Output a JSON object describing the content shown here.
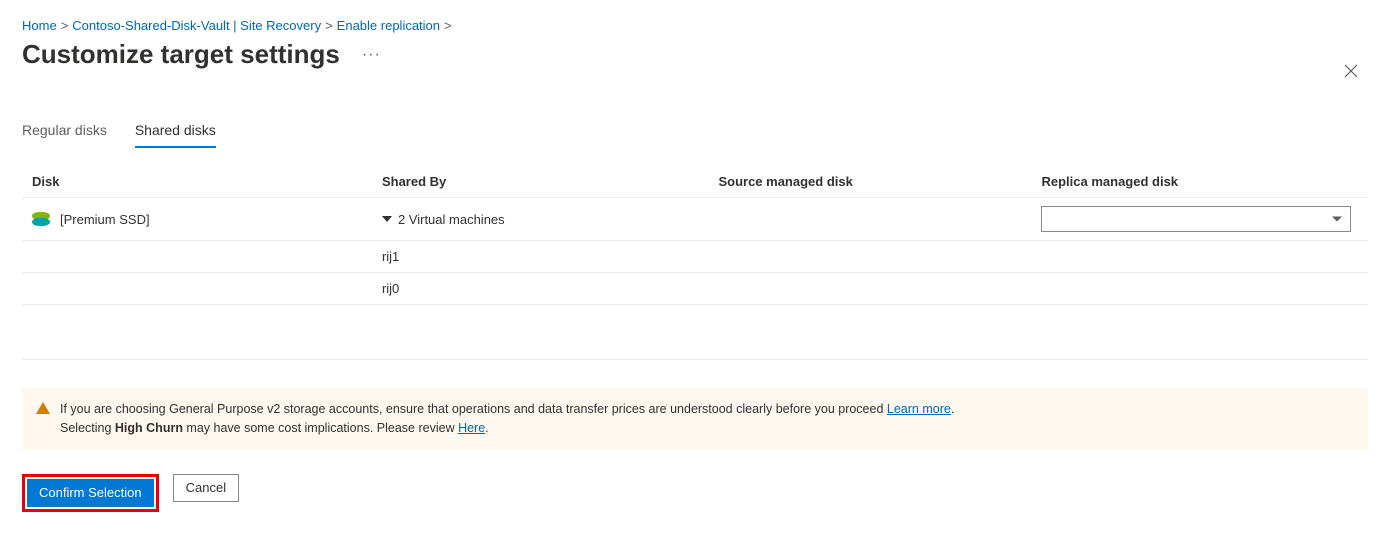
{
  "breadcrumb": {
    "items": [
      "Home",
      "Contoso-Shared-Disk-Vault | Site Recovery",
      "Enable replication"
    ],
    "sep": ">"
  },
  "header": {
    "title": "Customize target settings",
    "more": "···"
  },
  "tabs": {
    "items": [
      {
        "label": "Regular disks",
        "active": false
      },
      {
        "label": "Shared disks",
        "active": true
      }
    ]
  },
  "table": {
    "columns": {
      "disk": "Disk",
      "shared_by": "Shared By",
      "source": "Source managed disk",
      "replica": "Replica managed disk"
    },
    "rows": [
      {
        "disk_label": "[Premium SSD]",
        "shared_by": "2 Virtual machines",
        "source": "",
        "replica": ""
      }
    ],
    "subrows": [
      "rij1",
      "rij0"
    ]
  },
  "info": {
    "text1": "If you are choosing General Purpose v2 storage accounts, ensure that operations and data transfer prices are understood clearly before you proceed ",
    "learn_more": "Learn more",
    "period": ".",
    "text2a": "Selecting ",
    "bold": "High Churn",
    "text2b": " may have some cost implications. Please review ",
    "here": "Here",
    "period2": "."
  },
  "buttons": {
    "confirm": "Confirm Selection",
    "cancel": "Cancel"
  }
}
